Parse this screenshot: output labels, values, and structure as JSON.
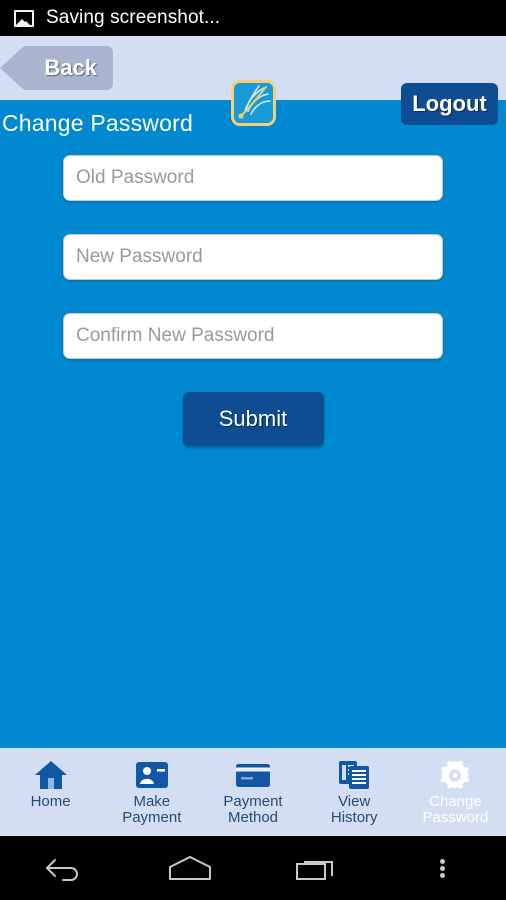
{
  "status_bar": {
    "icon": "image-screenshot-icon",
    "text": "Saving screenshot..."
  },
  "header": {
    "back_label": "Back",
    "logo_icon": "sun-burst-logo",
    "logout_label": "Logout"
  },
  "page": {
    "title": "Change Password",
    "fields": [
      {
        "name": "old-password",
        "placeholder": "Old Password",
        "value": ""
      },
      {
        "name": "new-password",
        "placeholder": "New Password",
        "value": ""
      },
      {
        "name": "confirm-new-password",
        "placeholder": "Confirm New Password",
        "value": ""
      }
    ],
    "submit_label": "Submit"
  },
  "tabbar": {
    "items": [
      {
        "label": "Home",
        "icon": "home-icon",
        "active": false
      },
      {
        "label": "Make\nPayment",
        "icon": "contact-card-icon",
        "active": false
      },
      {
        "label": "Payment\nMethod",
        "icon": "credit-card-icon",
        "active": false
      },
      {
        "label": "View\nHistory",
        "icon": "documents-icon",
        "active": false
      },
      {
        "label": "Change\nPassword",
        "icon": "gear-icon",
        "active": true
      }
    ]
  },
  "android_nav": {
    "back": "back-arrow-icon",
    "home": "home-pentagon-icon",
    "recents": "recent-apps-icon",
    "menu": "overflow-menu-icon"
  },
  "colors": {
    "page_background": "#0089d0",
    "header_background": "#d3def2",
    "accent_dark": "#0e4d91",
    "back_button": "#aab4cf",
    "logo_border": "#f5cf7e"
  }
}
